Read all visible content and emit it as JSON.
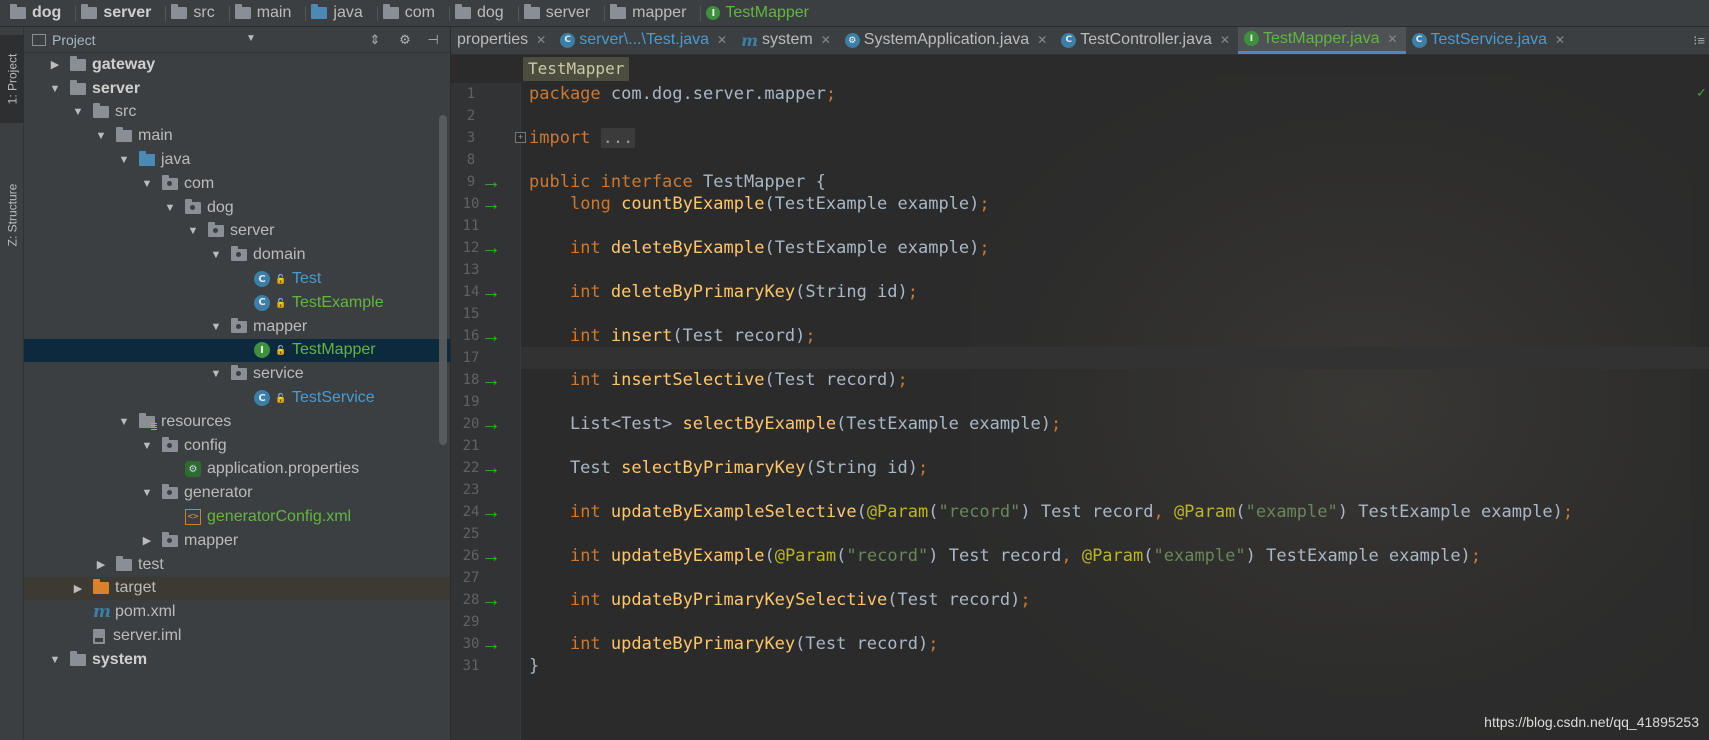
{
  "breadcrumb": [
    {
      "label": "dog",
      "kind": "module",
      "bold": true
    },
    {
      "label": "server",
      "kind": "module",
      "bold": true
    },
    {
      "label": "src",
      "kind": "folder"
    },
    {
      "label": "main",
      "kind": "folder"
    },
    {
      "label": "java",
      "kind": "source-root"
    },
    {
      "label": "com",
      "kind": "package"
    },
    {
      "label": "dog",
      "kind": "package"
    },
    {
      "label": "server",
      "kind": "package"
    },
    {
      "label": "mapper",
      "kind": "package"
    },
    {
      "label": "TestMapper",
      "kind": "interface",
      "badge": "I"
    }
  ],
  "toolstrip": {
    "project_tab": "1: Project",
    "structure_tab": "Z: Structure"
  },
  "project_panel": {
    "title": "Project",
    "dropdown_icon": "chevron-down-icon",
    "tree": [
      {
        "label": "gateway",
        "indent": 1,
        "arrow": "collapsed",
        "icon": "module-folder",
        "style": "bold"
      },
      {
        "label": "server",
        "indent": 1,
        "arrow": "expanded",
        "icon": "module-folder",
        "style": "bold"
      },
      {
        "label": "src",
        "indent": 2,
        "arrow": "expanded",
        "icon": "folder"
      },
      {
        "label": "main",
        "indent": 3,
        "arrow": "expanded",
        "icon": "folder"
      },
      {
        "label": "java",
        "indent": 4,
        "arrow": "expanded",
        "icon": "source-root"
      },
      {
        "label": "com",
        "indent": 5,
        "arrow": "expanded",
        "icon": "package"
      },
      {
        "label": "dog",
        "indent": 6,
        "arrow": "expanded",
        "icon": "package"
      },
      {
        "label": "server",
        "indent": 7,
        "arrow": "expanded",
        "icon": "package"
      },
      {
        "label": "domain",
        "indent": 8,
        "arrow": "expanded",
        "icon": "package"
      },
      {
        "label": "Test",
        "indent": 9,
        "arrow": "none",
        "icon": "class",
        "badge": "C",
        "style": "class"
      },
      {
        "label": "TestExample",
        "indent": 9,
        "arrow": "none",
        "icon": "class",
        "badge": "C",
        "style": "green"
      },
      {
        "label": "mapper",
        "indent": 8,
        "arrow": "expanded",
        "icon": "package"
      },
      {
        "label": "TestMapper",
        "indent": 9,
        "arrow": "none",
        "icon": "interface",
        "badge": "I",
        "style": "green",
        "selected": true
      },
      {
        "label": "service",
        "indent": 8,
        "arrow": "expanded",
        "icon": "package"
      },
      {
        "label": "TestService",
        "indent": 9,
        "arrow": "none",
        "icon": "class",
        "badge": "C",
        "style": "class"
      },
      {
        "label": "resources",
        "indent": 4,
        "arrow": "expanded",
        "icon": "resources"
      },
      {
        "label": "config",
        "indent": 5,
        "arrow": "expanded",
        "icon": "package"
      },
      {
        "label": "application.properties",
        "indent": 6,
        "arrow": "none",
        "icon": "properties-file"
      },
      {
        "label": "generator",
        "indent": 5,
        "arrow": "expanded",
        "icon": "package"
      },
      {
        "label": "generatorConfig.xml",
        "indent": 6,
        "arrow": "none",
        "icon": "xml-file",
        "style": "green"
      },
      {
        "label": "mapper",
        "indent": 5,
        "arrow": "collapsed",
        "icon": "package"
      },
      {
        "label": "test",
        "indent": 3,
        "arrow": "collapsed",
        "icon": "folder"
      },
      {
        "label": "target",
        "indent": 2,
        "arrow": "collapsed",
        "icon": "excluded-folder",
        "excluded": true
      },
      {
        "label": "pom.xml",
        "indent": 2,
        "arrow": "none",
        "icon": "maven-file"
      },
      {
        "label": "server.iml",
        "indent": 2,
        "arrow": "none",
        "icon": "iml-file"
      },
      {
        "label": "system",
        "indent": 1,
        "arrow": "expanded",
        "icon": "module-folder",
        "style": "bold"
      }
    ]
  },
  "tabs": [
    {
      "label": "properties",
      "icon": "none",
      "close": true,
      "style": "plain",
      "clipped": true
    },
    {
      "label": "server\\...\\Test.java",
      "icon": "class-icon",
      "badge": "C",
      "close": true,
      "style": "blue"
    },
    {
      "label": "system",
      "icon": "maven-icon",
      "close": true,
      "style": "plain"
    },
    {
      "label": "SystemApplication.java",
      "icon": "spring-boot-icon",
      "close": true,
      "style": "plain"
    },
    {
      "label": "TestController.java",
      "icon": "class-icon",
      "badge": "C",
      "close": true,
      "style": "plain"
    },
    {
      "label": "TestMapper.java",
      "icon": "interface-icon",
      "badge": "I",
      "close": true,
      "style": "green",
      "active": true
    },
    {
      "label": "TestService.java",
      "icon": "class-icon",
      "badge": "C",
      "close": true,
      "style": "blue"
    }
  ],
  "editor": {
    "breadcrumb_class": "TestMapper",
    "lines": [
      {
        "n": "1",
        "impl": false,
        "fold": false,
        "tokens": [
          [
            "kw",
            "package"
          ],
          [
            "pl",
            " com.dog.server.mapper"
          ],
          [
            "kw",
            ";"
          ]
        ]
      },
      {
        "n": "2",
        "impl": false,
        "fold": false,
        "tokens": []
      },
      {
        "n": "3",
        "impl": false,
        "fold": true,
        "tokens": [
          [
            "kw",
            "import"
          ],
          [
            "pl",
            " "
          ],
          [
            "dots",
            "..."
          ]
        ]
      },
      {
        "n": "8",
        "impl": false,
        "fold": false,
        "tokens": []
      },
      {
        "n": "9",
        "impl": true,
        "fold": false,
        "tokens": [
          [
            "kw",
            "public interface"
          ],
          [
            "pl",
            " TestMapper {"
          ]
        ]
      },
      {
        "n": "10",
        "impl": true,
        "fold": false,
        "tokens": [
          [
            "pl",
            "    "
          ],
          [
            "kw",
            "long"
          ],
          [
            "pl",
            " "
          ],
          [
            "fn",
            "countByExample"
          ],
          [
            "pl",
            "(TestExample example)"
          ],
          [
            "kw",
            ";"
          ]
        ]
      },
      {
        "n": "11",
        "impl": false,
        "fold": false,
        "tokens": []
      },
      {
        "n": "12",
        "impl": true,
        "fold": false,
        "tokens": [
          [
            "pl",
            "    "
          ],
          [
            "kw",
            "int"
          ],
          [
            "pl",
            " "
          ],
          [
            "fn",
            "deleteByExample"
          ],
          [
            "pl",
            "(TestExample example)"
          ],
          [
            "kw",
            ";"
          ]
        ]
      },
      {
        "n": "13",
        "impl": false,
        "fold": false,
        "tokens": []
      },
      {
        "n": "14",
        "impl": true,
        "fold": false,
        "tokens": [
          [
            "pl",
            "    "
          ],
          [
            "kw",
            "int"
          ],
          [
            "pl",
            " "
          ],
          [
            "fn",
            "deleteByPrimaryKey"
          ],
          [
            "pl",
            "(String id)"
          ],
          [
            "kw",
            ";"
          ]
        ]
      },
      {
        "n": "15",
        "impl": false,
        "fold": false,
        "tokens": []
      },
      {
        "n": "16",
        "impl": true,
        "fold": false,
        "tokens": [
          [
            "pl",
            "    "
          ],
          [
            "kw",
            "int"
          ],
          [
            "pl",
            " "
          ],
          [
            "fn",
            "insert"
          ],
          [
            "pl",
            "(Test record)"
          ],
          [
            "kw",
            ";"
          ]
        ]
      },
      {
        "n": "17",
        "impl": false,
        "fold": false,
        "tokens": []
      },
      {
        "n": "18",
        "impl": true,
        "fold": false,
        "tokens": [
          [
            "pl",
            "    "
          ],
          [
            "kw",
            "int"
          ],
          [
            "pl",
            " "
          ],
          [
            "fn",
            "insertSelective"
          ],
          [
            "pl",
            "(Test record)"
          ],
          [
            "kw",
            ";"
          ]
        ]
      },
      {
        "n": "19",
        "impl": false,
        "fold": false,
        "tokens": []
      },
      {
        "n": "20",
        "impl": true,
        "fold": false,
        "tokens": [
          [
            "pl",
            "    List<Test> "
          ],
          [
            "fn",
            "selectByExample"
          ],
          [
            "pl",
            "(TestExample example)"
          ],
          [
            "kw",
            ";"
          ]
        ]
      },
      {
        "n": "21",
        "impl": false,
        "fold": false,
        "tokens": []
      },
      {
        "n": "22",
        "impl": true,
        "fold": false,
        "tokens": [
          [
            "pl",
            "    Test "
          ],
          [
            "fn",
            "selectByPrimaryKey"
          ],
          [
            "pl",
            "(String id)"
          ],
          [
            "kw",
            ";"
          ]
        ]
      },
      {
        "n": "23",
        "impl": false,
        "fold": false,
        "tokens": []
      },
      {
        "n": "24",
        "impl": true,
        "fold": false,
        "tokens": [
          [
            "pl",
            "    "
          ],
          [
            "kw",
            "int"
          ],
          [
            "pl",
            " "
          ],
          [
            "fn",
            "updateByExampleSelective"
          ],
          [
            "pl",
            "("
          ],
          [
            "ann",
            "@Param"
          ],
          [
            "pl",
            "("
          ],
          [
            "str",
            "\"record\""
          ],
          [
            "pl",
            ") Test record"
          ],
          [
            "kw",
            ","
          ],
          [
            "pl",
            " "
          ],
          [
            "ann",
            "@Param"
          ],
          [
            "pl",
            "("
          ],
          [
            "str",
            "\"example\""
          ],
          [
            "pl",
            ") TestExample example)"
          ],
          [
            "kw",
            ";"
          ]
        ]
      },
      {
        "n": "25",
        "impl": false,
        "fold": false,
        "tokens": []
      },
      {
        "n": "26",
        "impl": true,
        "fold": false,
        "tokens": [
          [
            "pl",
            "    "
          ],
          [
            "kw",
            "int"
          ],
          [
            "pl",
            " "
          ],
          [
            "fn",
            "updateByExample"
          ],
          [
            "pl",
            "("
          ],
          [
            "ann",
            "@Param"
          ],
          [
            "pl",
            "("
          ],
          [
            "str",
            "\"record\""
          ],
          [
            "pl",
            ") Test record"
          ],
          [
            "kw",
            ","
          ],
          [
            "pl",
            " "
          ],
          [
            "ann",
            "@Param"
          ],
          [
            "pl",
            "("
          ],
          [
            "str",
            "\"example\""
          ],
          [
            "pl",
            ") TestExample example)"
          ],
          [
            "kw",
            ";"
          ]
        ]
      },
      {
        "n": "27",
        "impl": false,
        "fold": false,
        "tokens": []
      },
      {
        "n": "28",
        "impl": true,
        "fold": false,
        "tokens": [
          [
            "pl",
            "    "
          ],
          [
            "kw",
            "int"
          ],
          [
            "pl",
            " "
          ],
          [
            "fn",
            "updateByPrimaryKeySelective"
          ],
          [
            "pl",
            "(Test record)"
          ],
          [
            "kw",
            ";"
          ]
        ]
      },
      {
        "n": "29",
        "impl": false,
        "fold": false,
        "tokens": []
      },
      {
        "n": "30",
        "impl": true,
        "fold": false,
        "tokens": [
          [
            "pl",
            "    "
          ],
          [
            "kw",
            "int"
          ],
          [
            "pl",
            " "
          ],
          [
            "fn",
            "updateByPrimaryKey"
          ],
          [
            "pl",
            "(Test record)"
          ],
          [
            "kw",
            ";"
          ]
        ]
      },
      {
        "n": "31",
        "impl": false,
        "fold": false,
        "tokens": [
          [
            "pl",
            "}"
          ]
        ]
      }
    ],
    "watermark": "https://blog.csdn.net/qq_41895253"
  },
  "colors": {
    "background": "#2b2b2b",
    "panel": "#3c3f41",
    "keyword": "#cc7832",
    "function": "#ffc66d",
    "string": "#6a8759",
    "annotation": "#bbb529",
    "selection": "#0d293e",
    "interface_green": "#62b543",
    "class_blue": "#4a9bd1"
  }
}
